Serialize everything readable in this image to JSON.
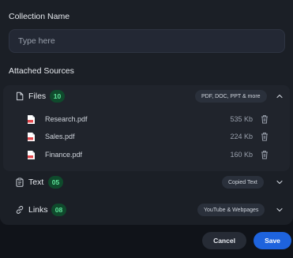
{
  "collection": {
    "label": "Collection Name",
    "placeholder": "Type here"
  },
  "sources": {
    "label": "Attached Sources",
    "groups": [
      {
        "title": "Files",
        "count": "10",
        "pill": "PDF, DOC, PPT & more",
        "icon": "file-icon",
        "expanded": true,
        "items": [
          {
            "name": "Research.pdf",
            "size": "535 Kb",
            "icon": "pdf-icon"
          },
          {
            "name": "Sales.pdf",
            "size": "224 Kb",
            "icon": "pdf-icon"
          },
          {
            "name": "Finance.pdf",
            "size": "160 Kb",
            "icon": "pdf-icon"
          }
        ]
      },
      {
        "title": "Text",
        "count": "05",
        "pill": "Copied Text",
        "icon": "clipboard-icon",
        "expanded": false
      },
      {
        "title": "Links",
        "count": "08",
        "pill": "YouTube & Webpages",
        "icon": "link-icon",
        "expanded": false
      }
    ]
  },
  "actions": {
    "cancel_label": "Cancel",
    "save_label": "Save"
  },
  "colors": {
    "accent": "#1e63dd",
    "count_badge_bg": "#0f4a2c",
    "count_badge_text": "#5fe39a",
    "pdf_icon": "#e5484d"
  }
}
